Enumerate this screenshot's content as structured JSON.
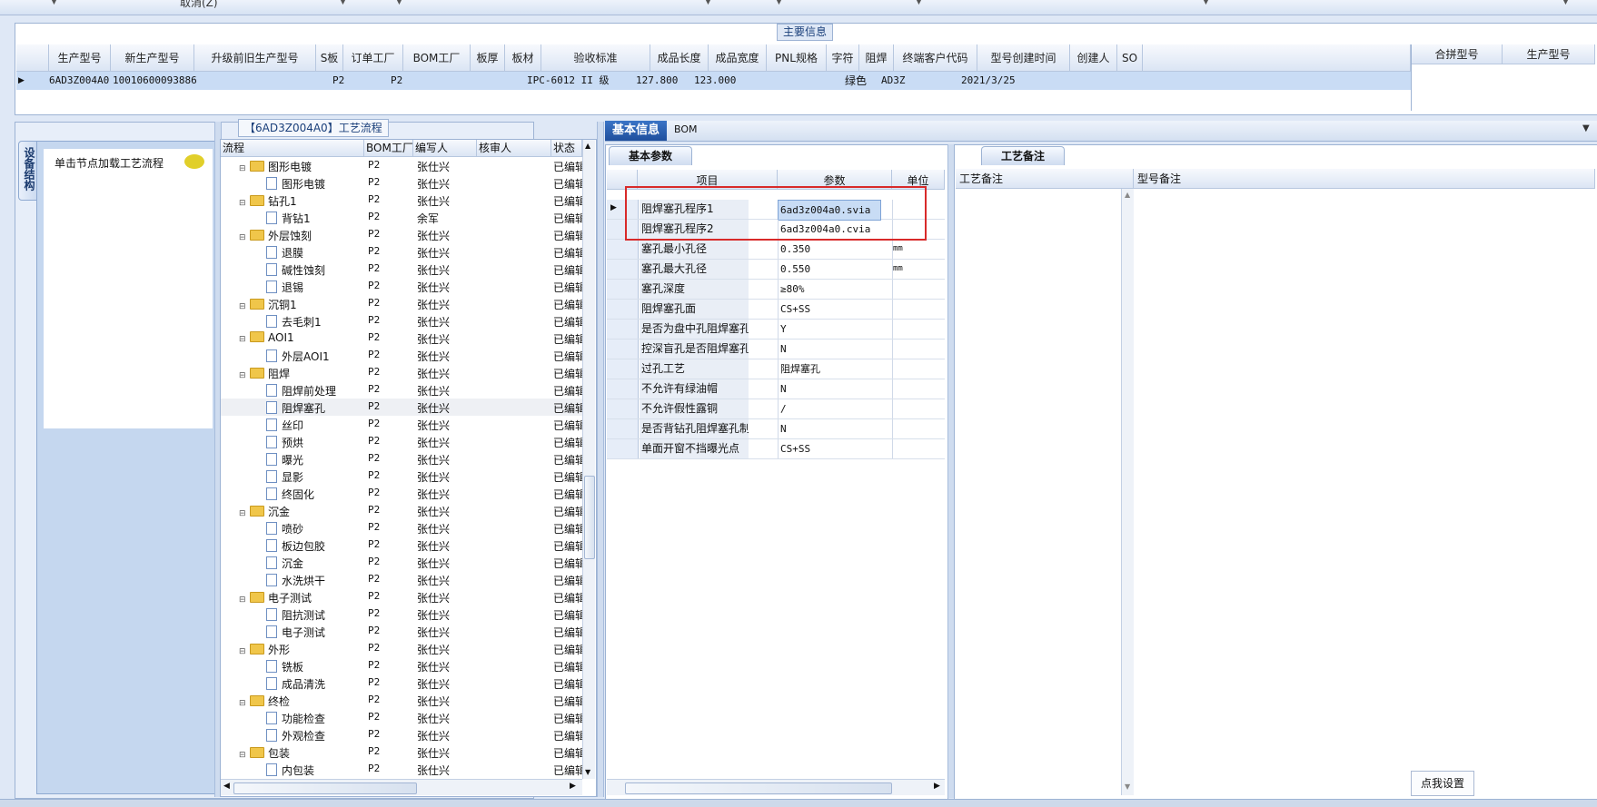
{
  "toolbar": {
    "cut_label": "取消(Z)"
  },
  "main_info": {
    "title": "主要信息",
    "columns": [
      "生产型号",
      "新生产型号",
      "升级前旧生产型号",
      "S板",
      "订单工厂",
      "BOM工厂",
      "板厚",
      "板材",
      "验收标准",
      "成品长度",
      "成品宽度",
      "PNL规格",
      "字符",
      "阻焊",
      "终端客户代码",
      "型号创建时间",
      "创建人",
      "SO"
    ],
    "row": {
      "model": "6AD3Z004A0",
      "new_model": "10010600093886",
      "order_factory": "P2",
      "bom_factory": "P2",
      "standard": "IPC-6012 II 级",
      "length": "127.800",
      "width": "123.000",
      "solder_mask": "绿色",
      "customer_code": "AD3Z",
      "create_time": "2021/3/25"
    },
    "right_columns": [
      "合拼型号",
      "生产型号"
    ]
  },
  "left_rail": {
    "tab_label": "设备结构",
    "node_hint": "单击节点加载工艺流程"
  },
  "flow": {
    "title": "【6AD3Z004A0】工艺流程",
    "columns": [
      "流程",
      "BOM工厂",
      "编写人",
      "核审人",
      "状态"
    ],
    "rows": [
      {
        "name": "图形电镀",
        "type": "folder",
        "level": 0,
        "factory": "P2",
        "writer": "张仕兴",
        "status": "已编辑"
      },
      {
        "name": "图形电镀",
        "type": "doc",
        "level": 1,
        "factory": "P2",
        "writer": "张仕兴",
        "status": "已编辑"
      },
      {
        "name": "钻孔1",
        "type": "folder",
        "level": 0,
        "factory": "P2",
        "writer": "张仕兴",
        "status": "已编辑"
      },
      {
        "name": "背钻1",
        "type": "doc",
        "level": 1,
        "factory": "P2",
        "writer": "余军",
        "status": "已编辑"
      },
      {
        "name": "外层蚀刻",
        "type": "folder",
        "level": 0,
        "factory": "P2",
        "writer": "张仕兴",
        "status": "已编辑"
      },
      {
        "name": "退膜",
        "type": "doc",
        "level": 1,
        "factory": "P2",
        "writer": "张仕兴",
        "status": "已编辑"
      },
      {
        "name": "碱性蚀刻",
        "type": "doc",
        "level": 1,
        "factory": "P2",
        "writer": "张仕兴",
        "status": "已编辑"
      },
      {
        "name": "退锡",
        "type": "doc",
        "level": 1,
        "factory": "P2",
        "writer": "张仕兴",
        "status": "已编辑"
      },
      {
        "name": "沉铜1",
        "type": "folder",
        "level": 0,
        "factory": "P2",
        "writer": "张仕兴",
        "status": "已编辑"
      },
      {
        "name": "去毛刺1",
        "type": "doc",
        "level": 1,
        "factory": "P2",
        "writer": "张仕兴",
        "status": "已编辑"
      },
      {
        "name": "AOI1",
        "type": "folder",
        "level": 0,
        "factory": "P2",
        "writer": "张仕兴",
        "status": "已编辑"
      },
      {
        "name": "外层AOI1",
        "type": "doc",
        "level": 1,
        "factory": "P2",
        "writer": "张仕兴",
        "status": "已编辑"
      },
      {
        "name": "阻焊",
        "type": "folder",
        "level": 0,
        "factory": "P2",
        "writer": "张仕兴",
        "status": "已编辑"
      },
      {
        "name": "阻焊前处理",
        "type": "doc",
        "level": 1,
        "factory": "P2",
        "writer": "张仕兴",
        "status": "已编辑"
      },
      {
        "name": "阻焊塞孔",
        "type": "doc",
        "level": 1,
        "factory": "P2",
        "writer": "张仕兴",
        "status": "已编辑",
        "selected": true
      },
      {
        "name": "丝印",
        "type": "doc",
        "level": 1,
        "factory": "P2",
        "writer": "张仕兴",
        "status": "已编辑"
      },
      {
        "name": "预烘",
        "type": "doc",
        "level": 1,
        "factory": "P2",
        "writer": "张仕兴",
        "status": "已编辑"
      },
      {
        "name": "曝光",
        "type": "doc",
        "level": 1,
        "factory": "P2",
        "writer": "张仕兴",
        "status": "已编辑"
      },
      {
        "name": "显影",
        "type": "doc",
        "level": 1,
        "factory": "P2",
        "writer": "张仕兴",
        "status": "已编辑"
      },
      {
        "name": "终固化",
        "type": "doc",
        "level": 1,
        "factory": "P2",
        "writer": "张仕兴",
        "status": "已编辑"
      },
      {
        "name": "沉金",
        "type": "folder",
        "level": 0,
        "factory": "P2",
        "writer": "张仕兴",
        "status": "已编辑"
      },
      {
        "name": "喷砂",
        "type": "doc",
        "level": 1,
        "factory": "P2",
        "writer": "张仕兴",
        "status": "已编辑"
      },
      {
        "name": "板边包胶",
        "type": "doc",
        "level": 1,
        "factory": "P2",
        "writer": "张仕兴",
        "status": "已编辑"
      },
      {
        "name": "沉金",
        "type": "doc",
        "level": 1,
        "factory": "P2",
        "writer": "张仕兴",
        "status": "已编辑"
      },
      {
        "name": "水洗烘干",
        "type": "doc",
        "level": 1,
        "factory": "P2",
        "writer": "张仕兴",
        "status": "已编辑"
      },
      {
        "name": "电子测试",
        "type": "folder",
        "level": 0,
        "factory": "P2",
        "writer": "张仕兴",
        "status": "已编辑"
      },
      {
        "name": "阻抗测试",
        "type": "doc",
        "level": 1,
        "factory": "P2",
        "writer": "张仕兴",
        "status": "已编辑"
      },
      {
        "name": "电子测试",
        "type": "doc",
        "level": 1,
        "factory": "P2",
        "writer": "张仕兴",
        "status": "已编辑"
      },
      {
        "name": "外形",
        "type": "folder",
        "level": 0,
        "factory": "P2",
        "writer": "张仕兴",
        "status": "已编辑"
      },
      {
        "name": "铣板",
        "type": "doc",
        "level": 1,
        "factory": "P2",
        "writer": "张仕兴",
        "status": "已编辑"
      },
      {
        "name": "成品清洗",
        "type": "doc",
        "level": 1,
        "factory": "P2",
        "writer": "张仕兴",
        "status": "已编辑"
      },
      {
        "name": "终检",
        "type": "folder",
        "level": 0,
        "factory": "P2",
        "writer": "张仕兴",
        "status": "已编辑"
      },
      {
        "name": "功能检查",
        "type": "doc",
        "level": 1,
        "factory": "P2",
        "writer": "张仕兴",
        "status": "已编辑"
      },
      {
        "name": "外观检查",
        "type": "doc",
        "level": 1,
        "factory": "P2",
        "writer": "张仕兴",
        "status": "已编辑"
      },
      {
        "name": "包装",
        "type": "folder",
        "level": 0,
        "factory": "P2",
        "writer": "张仕兴",
        "status": "已编辑"
      },
      {
        "name": "内包装",
        "type": "doc",
        "level": 1,
        "factory": "P2",
        "writer": "张仕兴",
        "status": "已编辑"
      }
    ]
  },
  "right_tabs": {
    "basic": "基本信息",
    "bom": "BOM"
  },
  "params": {
    "tab": "基本参数",
    "columns": [
      "项目",
      "参数",
      "单位"
    ],
    "rows": [
      {
        "item": "阻焊塞孔程序1",
        "value": "6ad3z004a0.svia",
        "unit": ""
      },
      {
        "item": "阻焊塞孔程序2",
        "value": "6ad3z004a0.cvia",
        "unit": ""
      },
      {
        "item": "塞孔最小孔径",
        "value": "0.350",
        "unit": "mm"
      },
      {
        "item": "塞孔最大孔径",
        "value": "0.550",
        "unit": "mm"
      },
      {
        "item": "塞孔深度",
        "value": "≥80%",
        "unit": ""
      },
      {
        "item": "阻焊塞孔面",
        "value": "CS+SS",
        "unit": ""
      },
      {
        "item": "是否为盘中孔阻焊塞孔",
        "value": "Y",
        "unit": ""
      },
      {
        "item": "控深盲孔是否阻焊塞孔制作",
        "value": "N",
        "unit": ""
      },
      {
        "item": "过孔工艺",
        "value": "阻焊塞孔",
        "unit": ""
      },
      {
        "item": "不允许有绿油帽",
        "value": "N",
        "unit": ""
      },
      {
        "item": "不允许假性露铜",
        "value": "/",
        "unit": ""
      },
      {
        "item": "是否背钻孔阻焊塞孔制作",
        "value": "N",
        "unit": ""
      },
      {
        "item": "单面开窗不挡曝光点",
        "value": "CS+SS",
        "unit": ""
      }
    ]
  },
  "notes": {
    "tab": "工艺备注",
    "col1": "工艺备注",
    "col2": "型号备注",
    "settings_button": "点我设置"
  }
}
